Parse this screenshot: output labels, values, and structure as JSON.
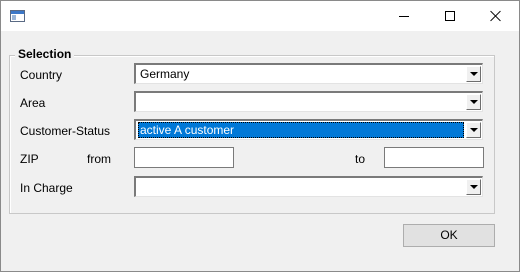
{
  "window": {
    "icon": "app-window-icon",
    "controls": {
      "minimize": "minimize-icon",
      "maximize": "maximize-icon",
      "close": "close-icon"
    }
  },
  "selection": {
    "title": "Selection",
    "country": {
      "label": "Country",
      "value": "Germany"
    },
    "area": {
      "label": "Area",
      "value": ""
    },
    "customer_status": {
      "label": "Customer-Status",
      "value": "active A customer"
    },
    "zip": {
      "label": "ZIP",
      "from_label": "from",
      "to_label": "to",
      "from_value": "",
      "to_value": ""
    },
    "in_charge": {
      "label": "In Charge",
      "value": ""
    }
  },
  "buttons": {
    "ok": "OK"
  },
  "colors": {
    "selection_highlight": "#0078d7",
    "window_bg": "#f0f0f0",
    "titlebar_bg": "#ffffff"
  }
}
